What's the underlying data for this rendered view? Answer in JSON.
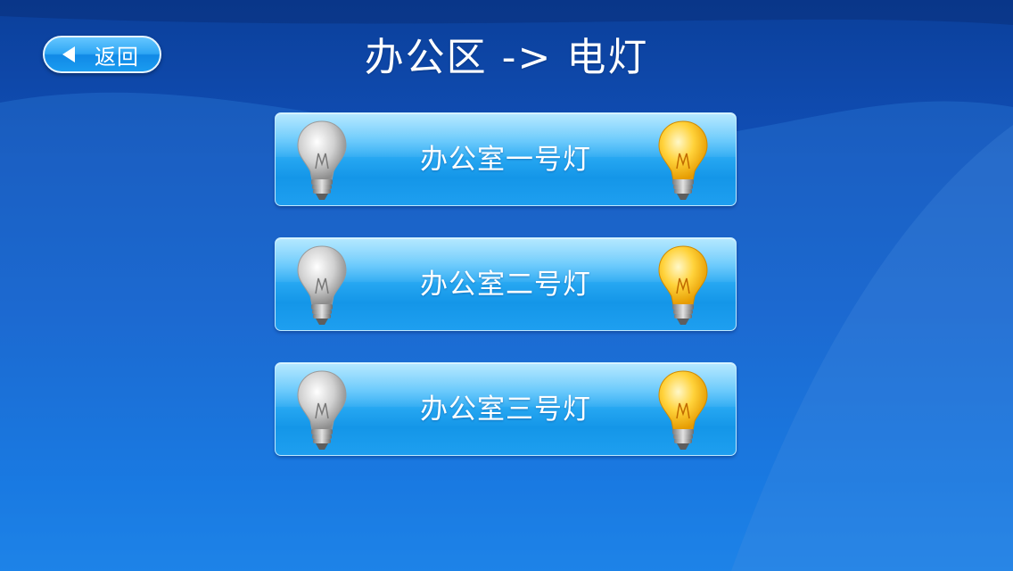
{
  "header": {
    "back_label": "返回",
    "title": "办公区 -> 电灯"
  },
  "lights": [
    {
      "label": "办公室一号灯",
      "off_icon": "bulb-off-icon",
      "on_icon": "bulb-on-icon"
    },
    {
      "label": "办公室二号灯",
      "off_icon": "bulb-off-icon",
      "on_icon": "bulb-on-icon"
    },
    {
      "label": "办公室三号灯",
      "off_icon": "bulb-off-icon",
      "on_icon": "bulb-on-icon"
    }
  ],
  "colors": {
    "background_top": "#0b3f9a",
    "background_bottom": "#1586f0",
    "button_blue": "#25a6f1",
    "bulb_on": "#ffc21a",
    "bulb_off": "#c8c8c8"
  }
}
